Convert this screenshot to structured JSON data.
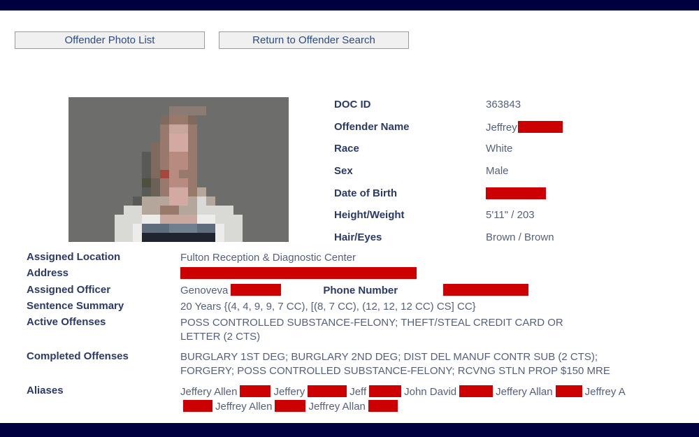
{
  "chrome": {
    "top_bar_color": "#000040",
    "bottom_bar_color": "#000040"
  },
  "toolbar": {
    "photo_list_label": "Offender Photo List",
    "return_search_label": "Return to Offender Search"
  },
  "photo": {
    "alt": "offender-mugshot-pixelated"
  },
  "summary_fields": [
    {
      "label": "DOC ID",
      "value": "363843",
      "redacted": false,
      "redact_width": 0
    },
    {
      "label": "Offender Name",
      "value": "Jeffrey",
      "redacted": true,
      "redact_width": 64
    },
    {
      "label": "Race",
      "value": "White",
      "redacted": false,
      "redact_width": 0
    },
    {
      "label": "Sex",
      "value": "Male",
      "redacted": false,
      "redact_width": 0
    },
    {
      "label": "Date of Birth",
      "value": "",
      "redacted": true,
      "redact_width": 86
    },
    {
      "label": "Height/Weight",
      "value": "5'11\" / 203",
      "redacted": false,
      "redact_width": 0
    },
    {
      "label": "Hair/Eyes",
      "value": "Brown / Brown",
      "redacted": false,
      "redact_width": 0
    }
  ],
  "detail": {
    "assigned_location_label": "Assigned Location",
    "assigned_location_value": "Fulton Reception & Diagnostic Center",
    "address_label": "Address",
    "address_redact_width": 338,
    "assigned_officer_label": "Assigned Officer",
    "assigned_officer_value": "Genoveva",
    "assigned_officer_redact_width": 72,
    "phone_number_label": "Phone Number",
    "phone_number_redact_width": 122,
    "sentence_summary_label": "Sentence Summary",
    "sentence_summary_value": "20 Years {(4, 4, 9, 9, 7 CC), [(8, 7 CC), (12, 12, 12 CC) CS] CC}",
    "active_offenses_label": "Active Offenses",
    "active_offenses_value": "POSS CONTROLLED SUBSTANCE-FELONY; THEFT/STEAL CREDIT CARD OR LETTER (2 CTS)",
    "completed_offenses_label": "Completed Offenses",
    "completed_offenses_value": "BURGLARY 1ST DEG; BURGLARY 2ND DEG; DIST DEL MANUF CONTR SUB (2 CTS); FORGERY; POSS CONTROLLED SUBSTANCE-FELONY; RCVNG STLN PROP $150 MRE",
    "aliases_label": "Aliases"
  },
  "aliases": {
    "line1": [
      {
        "text": "Jeffery Allen",
        "redact_width": 44
      },
      {
        "text": "Jeffery",
        "redact_width": 56
      },
      {
        "text": "Jeff",
        "redact_width": 46
      },
      {
        "text": "John David",
        "redact_width": 48
      },
      {
        "text": "Jeffery Allan",
        "redact_width": 38
      },
      {
        "text": "Jeffrey A",
        "redact_width": 0
      }
    ],
    "line2": [
      {
        "text": "",
        "redact_width": 42
      },
      {
        "text": "Jeffrey Allen",
        "redact_width": 44
      },
      {
        "text": "Jeffrey Allan",
        "redact_width": 42
      }
    ]
  },
  "colors": {
    "label_text": "#2b3a67",
    "value_text": "#55607b",
    "redaction": "#cc0000",
    "button_text": "#2a4b82",
    "button_face": "#f0f0f0"
  }
}
